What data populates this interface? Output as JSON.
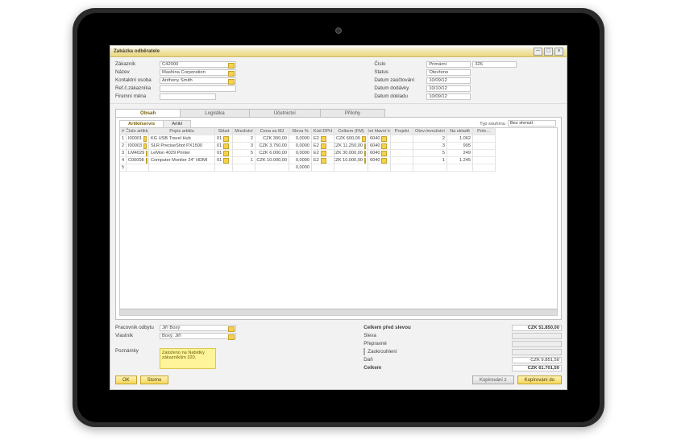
{
  "window": {
    "title": "Zakázka odběratele"
  },
  "header": {
    "left": [
      {
        "label": "Zákazník",
        "value": "C42000",
        "y": true
      },
      {
        "label": "Název",
        "value": "Mashina Corporation",
        "y": true
      },
      {
        "label": "Kontaktní osoba",
        "value": "Anthony Smith",
        "y": true
      },
      {
        "label": "Ref.č.zákazníka",
        "value": ""
      },
      {
        "label": "Firemní měna",
        "value": "",
        "sel": true
      }
    ],
    "right": [
      {
        "label": "Číslo",
        "value": "Primární",
        "value2": "326"
      },
      {
        "label": "Status",
        "value": "Otevřeno"
      },
      {
        "label": "Datum zaúčtování",
        "value": "10/09/12"
      },
      {
        "label": "Datum dodávky",
        "value": "10/10/12"
      },
      {
        "label": "Datum dokladu",
        "value": "10/09/12"
      }
    ]
  },
  "tabs": [
    "Obsah",
    "Logistika",
    "Účetnictví",
    "Přílohy"
  ],
  "subtabs": [
    "Artikl/servis",
    "Artikl"
  ],
  "summary": {
    "label": "Typ souhrnu",
    "value": "Bez shrnutí"
  },
  "grid": {
    "cols": [
      "#",
      "Číslo artiklu",
      "Popis artiklu",
      "Sklad",
      "Množství",
      "Cena za MJ",
      "Sleva %",
      "Kód DPH",
      "Celkem (FM)",
      "Účet hlavní k…",
      "Projekt",
      "Otev./množství",
      "Na skladě",
      "Potv…"
    ],
    "rows": [
      {
        "n": "1",
        "code": "I00001",
        "desc": "KG USB Travel Hub",
        "wh": "01",
        "qty": "2",
        "price": "CZK 300,00",
        "disc": "0,0000",
        "vat": "E2",
        "total": "CZK 600,00",
        "acct": "6040",
        "open": "2",
        "stock": "1.062"
      },
      {
        "n": "2",
        "code": "I00003",
        "desc": "SLR PreciseShot PX1500",
        "wh": "01",
        "qty": "3",
        "price": "CZK 3.750,00",
        "disc": "0,0000",
        "vat": "E2",
        "total": "CZK 11.250,00",
        "acct": "6040",
        "open": "3",
        "stock": "905"
      },
      {
        "n": "3",
        "code": "LM4029",
        "desc": "LeMon 4029 Printer",
        "wh": "01",
        "qty": "5",
        "price": "CZK 6.000,00",
        "disc": "0,0000",
        "vat": "E2",
        "total": "CZK 30.000,00",
        "acct": "6040",
        "open": "5",
        "stock": "249"
      },
      {
        "n": "4",
        "code": "C00008",
        "desc": "Computer Monitor 24\" HDMI",
        "wh": "01",
        "qty": "1",
        "price": "CZK 10.000,00",
        "disc": "0,0000",
        "vat": "E2",
        "total": "CZK 10.000,00",
        "acct": "6040",
        "open": "1",
        "stock": "1.245"
      },
      {
        "n": "5",
        "code": "",
        "desc": "",
        "wh": "",
        "qty": "",
        "price": "",
        "disc": "0,0000",
        "vat": "",
        "total": "",
        "acct": "",
        "open": "",
        "stock": ""
      }
    ]
  },
  "footer": {
    "owner_label": "Pracovník odbytu",
    "owner_value": "Jiří Boxý",
    "owner2_label": "Vlastník",
    "owner2_value": "Boxý, Jiří",
    "remarks_label": "Poznámky",
    "remarks_text": "Založeno na Nabídky zákazníkům 320.",
    "totals": [
      {
        "label": "Celkem před slevou",
        "value": "CZK 51.850,00",
        "bold": true
      },
      {
        "label": "Sleva",
        "value": ""
      },
      {
        "label": "Přepravné",
        "value": "",
        "arrow": true
      },
      {
        "label": "Zaokrouhlení",
        "value": "",
        "chk": true
      },
      {
        "label": "Daň",
        "value": "CZK 9.851,50"
      },
      {
        "label": "Celkem",
        "value": "CZK 61.701,50",
        "bold": true
      }
    ]
  },
  "actions": {
    "ok": "OK",
    "cancel": "Storno",
    "copyfrom": "Kopírování z",
    "copyto": "Kopírování do"
  }
}
